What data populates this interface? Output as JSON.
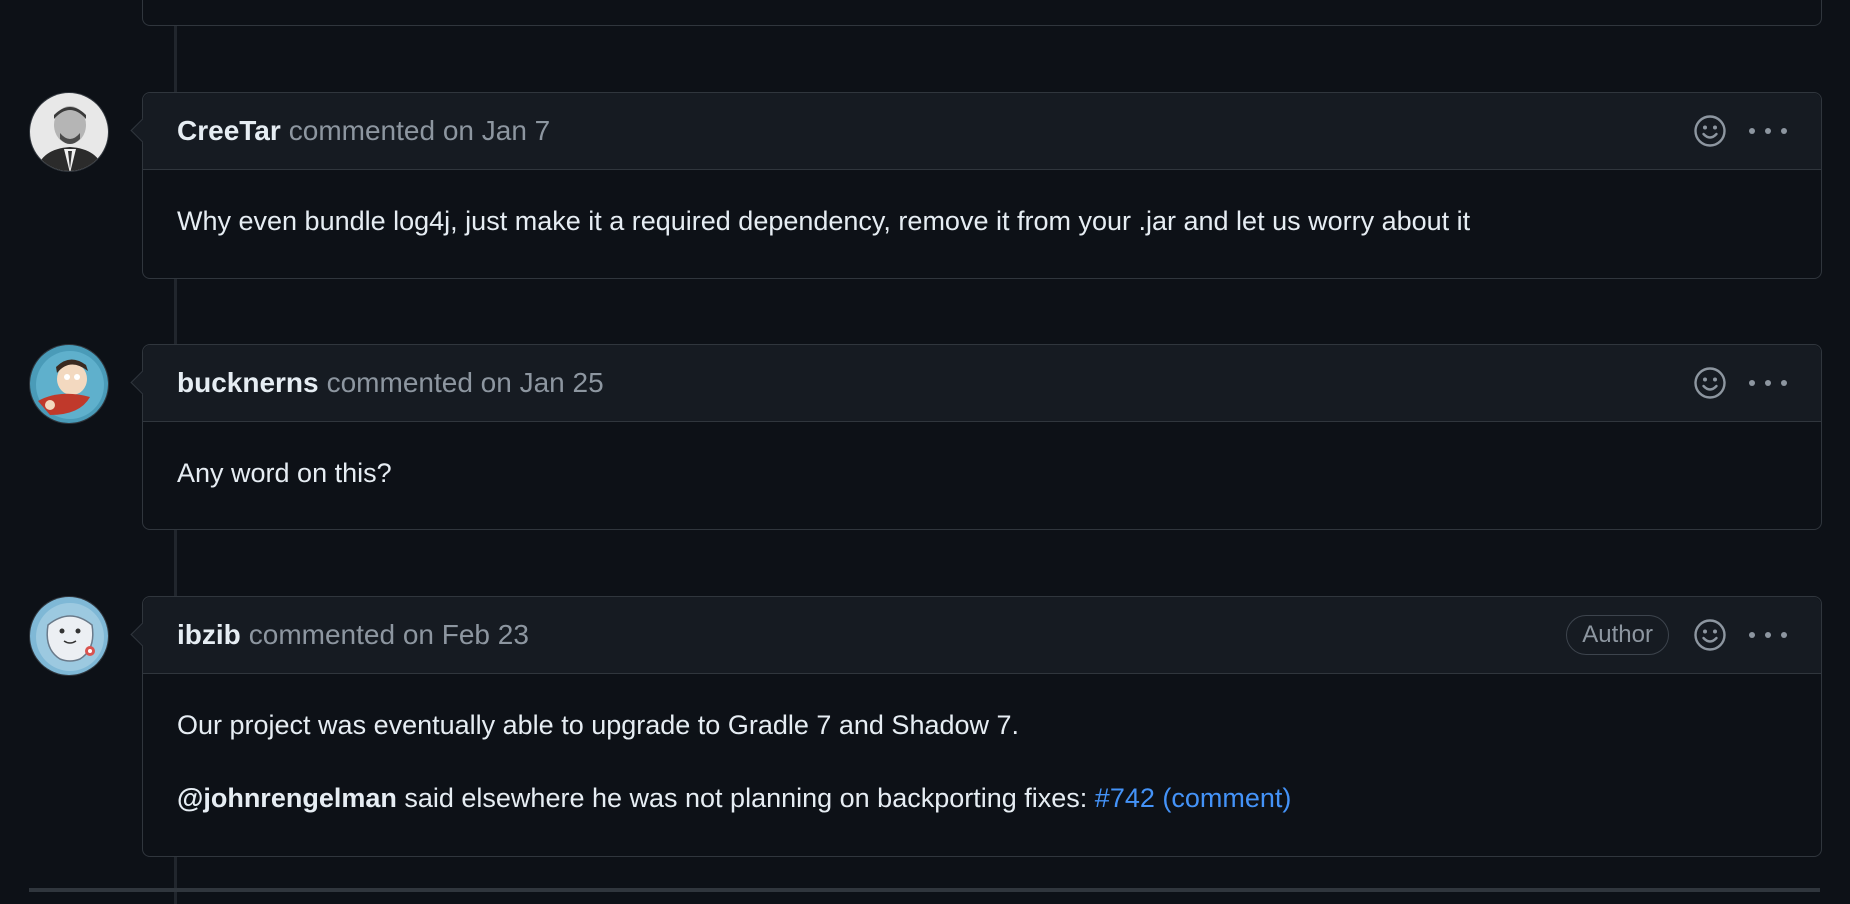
{
  "comments": [
    {
      "author": "CreeTar",
      "meta": "commented on Jan 7",
      "body_line1": "Why even bundle log4j, just make it a required dependency, remove it from your .jar and let us worry about it"
    },
    {
      "author": "bucknerns",
      "meta": "commented on Jan 25",
      "body_line1": "Any word on this?"
    },
    {
      "author": "ibzib",
      "meta": "commented on Feb 23",
      "badge": "Author",
      "body_line1": "Our project was eventually able to upgrade to Gradle 7 and Shadow 7.",
      "mention": "@johnrengelman",
      "body_line2": " said elsewhere he was not planning on backporting fixes: ",
      "issue_link": "#742",
      "comment_link": "(comment)"
    }
  ],
  "colors": {
    "background": "#0d1117",
    "header": "#161b22",
    "border": "#30363d",
    "link": "#4493f8",
    "muted": "#8d96a0"
  },
  "icons": [
    "smiley-icon",
    "kebab-horizontal-icon"
  ]
}
